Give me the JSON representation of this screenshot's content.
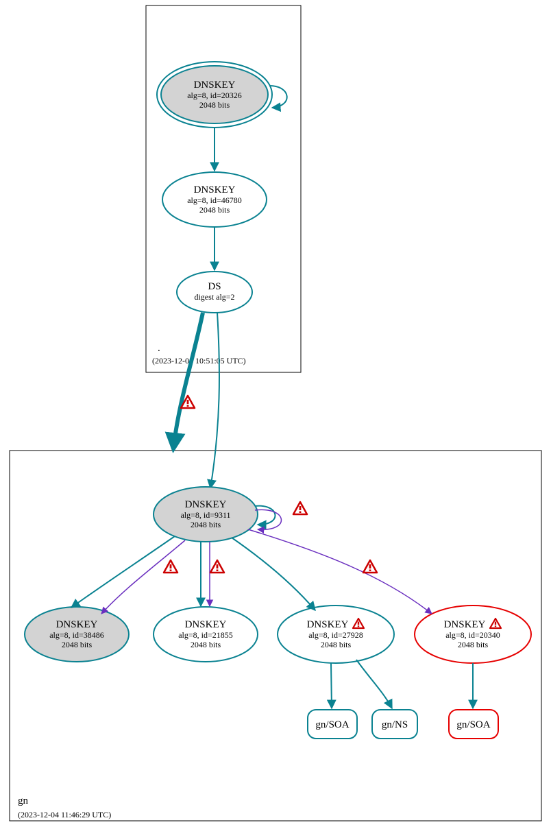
{
  "colors": {
    "teal": "#0a8291",
    "purple": "#6a2fbf",
    "red": "#e60000",
    "gray": "#d3d3d3",
    "box": "#000000"
  },
  "zones": {
    "root": {
      "label": ".",
      "timestamp": "(2023-12-04 10:51:05 UTC)"
    },
    "gn": {
      "label": "gn",
      "timestamp": "(2023-12-04 11:46:29 UTC)"
    }
  },
  "nodes": {
    "root_ksk": {
      "title": "DNSKEY",
      "sub1": "alg=8, id=20326",
      "sub2": "2048 bits"
    },
    "root_zsk": {
      "title": "DNSKEY",
      "sub1": "alg=8, id=46780",
      "sub2": "2048 bits"
    },
    "root_ds": {
      "title": "DS",
      "sub1": "digest alg=2"
    },
    "gn_ksk": {
      "title": "DNSKEY",
      "sub1": "alg=8, id=9311",
      "sub2": "2048 bits"
    },
    "gn_k1": {
      "title": "DNSKEY",
      "sub1": "alg=8, id=38486",
      "sub2": "2048 bits"
    },
    "gn_k2": {
      "title": "DNSKEY",
      "sub1": "alg=8, id=21855",
      "sub2": "2048 bits"
    },
    "gn_k3": {
      "title": "DNSKEY",
      "warn": "⚠",
      "sub1": "alg=8, id=27928",
      "sub2": "2048 bits"
    },
    "gn_k4": {
      "title": "DNSKEY",
      "warn": "⚠",
      "sub1": "alg=8, id=20340",
      "sub2": "2048 bits"
    },
    "rr1": {
      "label": "gn/SOA"
    },
    "rr2": {
      "label": "gn/NS"
    },
    "rr3": {
      "label": "gn/SOA"
    }
  },
  "warnings": {
    "w1": "⚠",
    "w2": "⚠",
    "w3": "⚠",
    "w4": "⚠",
    "w5": "⚠"
  }
}
